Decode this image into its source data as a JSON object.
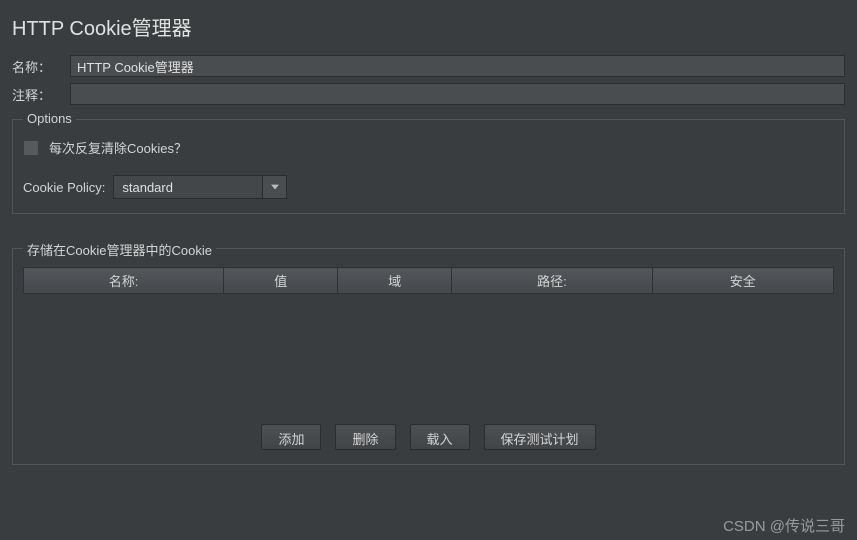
{
  "panel": {
    "title": "HTTP Cookie管理器"
  },
  "form": {
    "name_label": "名称：",
    "name_value": "HTTP Cookie管理器",
    "comment_label": "注释：",
    "comment_value": ""
  },
  "options": {
    "legend": "Options",
    "clear_checkbox_label": "每次反复清除Cookies？",
    "policy_label": "Cookie Policy:",
    "policy_value": "standard"
  },
  "stored": {
    "legend": "存储在Cookie管理器中的Cookie",
    "columns": [
      "名称:",
      "值",
      "域",
      "路径:",
      "安全"
    ]
  },
  "buttons": {
    "add": "添加",
    "delete": "删除",
    "load": "载入",
    "save": "保存测试计划"
  },
  "watermark": "CSDN @传说三哥"
}
